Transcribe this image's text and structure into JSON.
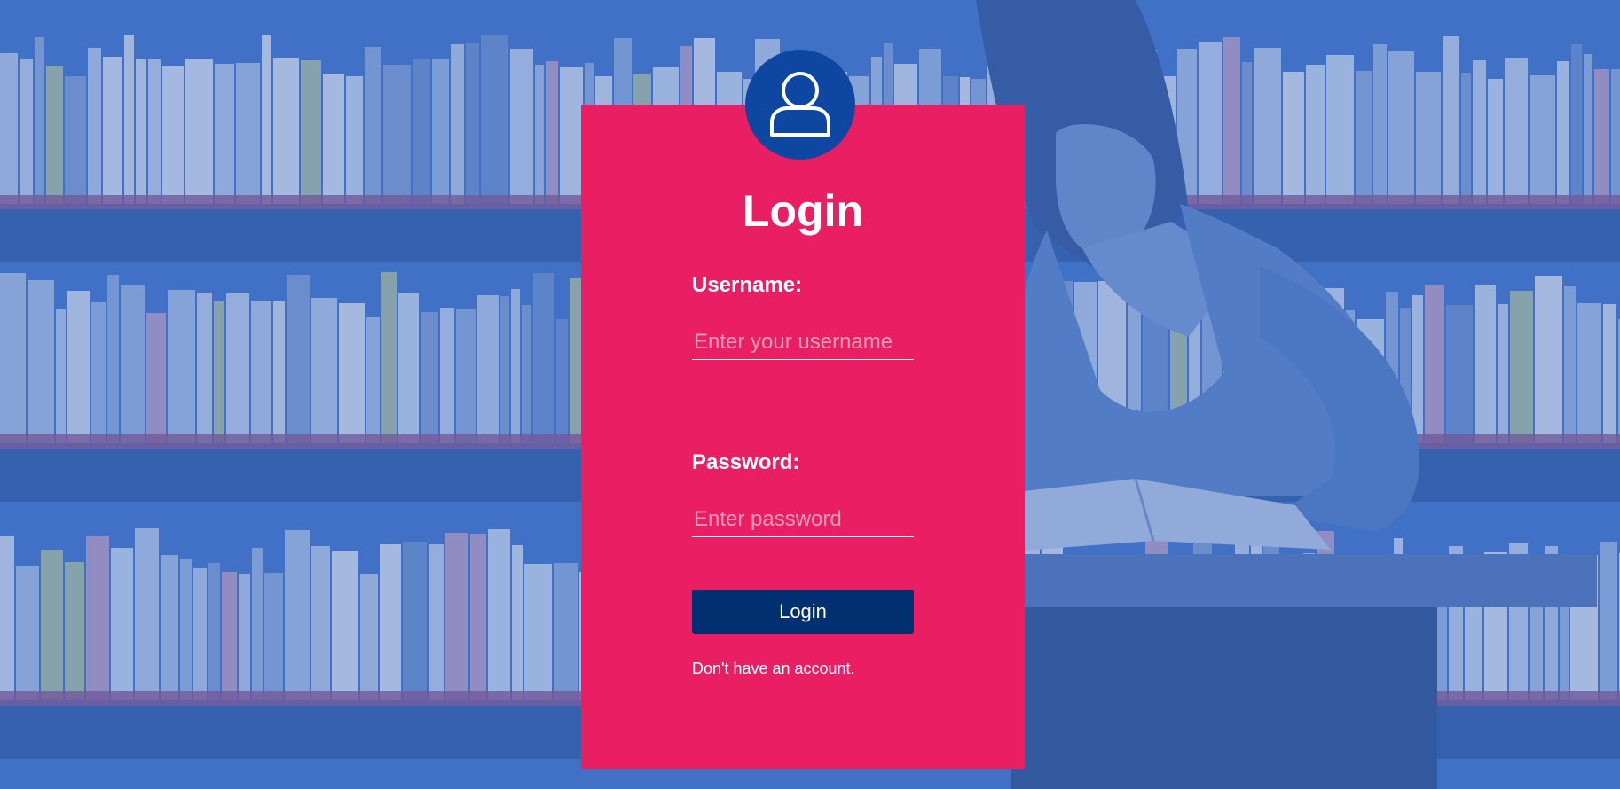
{
  "login_form": {
    "title": "Login",
    "username_label": "Username:",
    "username_placeholder": "Enter your username",
    "username_value": "",
    "password_label": "Password:",
    "password_placeholder": "Enter password",
    "password_value": "",
    "submit_label": "Login",
    "signup_text": "Don't have an account."
  },
  "icons": {
    "avatar": "user-icon"
  },
  "colors": {
    "card": "#e91e63",
    "avatar_circle": "#0d47a1",
    "button": "#003070",
    "background_tint": "#4d7fcf",
    "text": "#ffffff"
  }
}
